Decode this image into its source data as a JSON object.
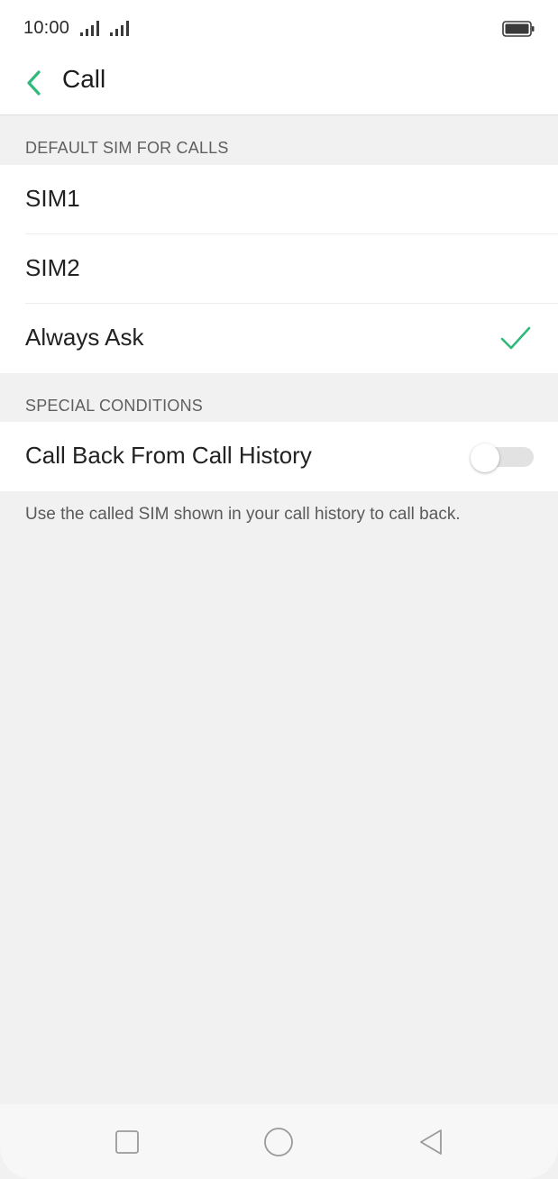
{
  "status_bar": {
    "time": "10:00",
    "icons": [
      "signal-icon",
      "signal-icon",
      "battery-icon"
    ]
  },
  "app_bar": {
    "title": "Call",
    "back_icon": "chevron-left-icon",
    "accent_color": "#2fb97a"
  },
  "sections": {
    "default_sim": {
      "header": "DEFAULT SIM FOR CALLS",
      "options": [
        {
          "label": "SIM1",
          "selected": false
        },
        {
          "label": "SIM2",
          "selected": false
        },
        {
          "label": "Always Ask",
          "selected": true
        }
      ]
    },
    "special_conditions": {
      "header": "SPECIAL CONDITIONS",
      "call_back": {
        "label": "Call Back From Call History",
        "enabled": false
      },
      "footnote": "Use the called SIM shown in your call history to call back."
    }
  },
  "nav_bar": {
    "icons": [
      "square-recents-icon",
      "circle-home-icon",
      "triangle-back-icon"
    ]
  }
}
